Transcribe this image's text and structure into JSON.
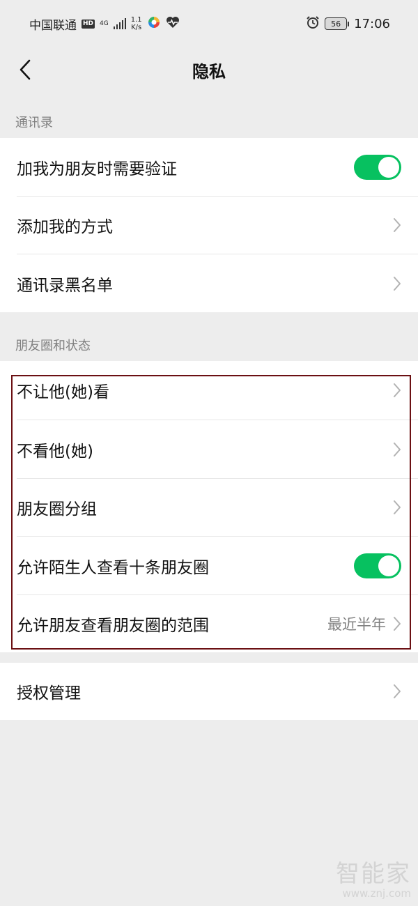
{
  "status_bar": {
    "carrier": "中国联通",
    "hd_badge": "HD",
    "network_type": "4G",
    "speed_value": "1.1",
    "speed_unit": "K/s",
    "battery": "56",
    "time": "17:06",
    "icons": [
      "hd-icon",
      "signal-icon",
      "app-icon",
      "health-icon",
      "alarm-icon",
      "battery-icon"
    ]
  },
  "nav": {
    "title": "隐私",
    "back_icon": "chevron-left-icon"
  },
  "sections": {
    "contacts": {
      "header": "通讯录",
      "items": [
        {
          "label": "加我为朋友时需要验证",
          "control": "toggle",
          "on": true
        },
        {
          "label": "添加我的方式",
          "control": "chevron"
        },
        {
          "label": "通讯录黑名单",
          "control": "chevron"
        }
      ]
    },
    "moments": {
      "header": "朋友圈和状态",
      "items": [
        {
          "label": "不让他(她)看",
          "control": "chevron"
        },
        {
          "label": "不看他(她)",
          "control": "chevron"
        },
        {
          "label": "朋友圈分组",
          "control": "chevron"
        },
        {
          "label": "允许陌生人查看十条朋友圈",
          "control": "toggle",
          "on": true
        },
        {
          "label": "允许朋友查看朋友圈的范围",
          "control": "chevron",
          "value": "最近半年"
        }
      ]
    },
    "auth": {
      "items": [
        {
          "label": "授权管理",
          "control": "chevron"
        }
      ]
    }
  },
  "watermark": {
    "brand": "智能家",
    "url": "www.znj.com"
  },
  "colors": {
    "toggle_on": "#07c160",
    "highlight_border": "#6b1013",
    "background": "#ededed"
  }
}
